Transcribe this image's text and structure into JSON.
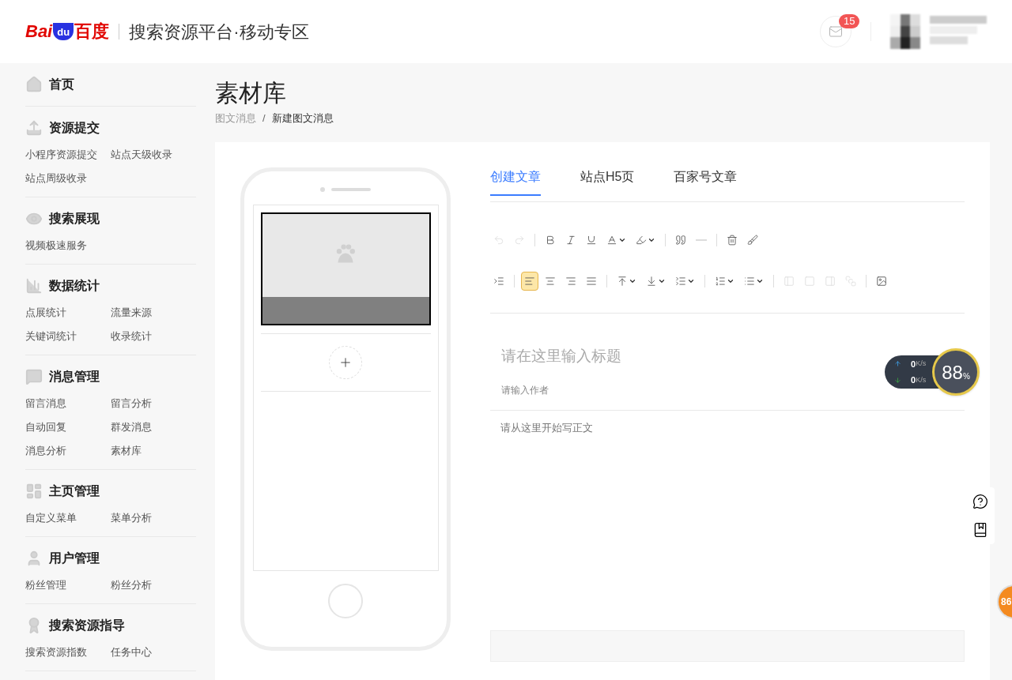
{
  "header": {
    "logo": {
      "latin": "Bai",
      "badge": "du",
      "chinese": "百度"
    },
    "platform_title": "搜索资源平台·移动专区",
    "mail_badge": "15"
  },
  "sidebar": [
    {
      "title": "首页"
    },
    {
      "title": "资源提交",
      "items": [
        "小程序资源提交",
        "站点天级收录",
        "站点周级收录"
      ]
    },
    {
      "title": "搜索展现",
      "items": [
        "视频极速服务"
      ]
    },
    {
      "title": "数据统计",
      "items": [
        "点展统计",
        "流量来源",
        "关键词统计",
        "收录统计"
      ]
    },
    {
      "title": "消息管理",
      "items": [
        "留言消息",
        "留言分析",
        "自动回复",
        "群发消息",
        "消息分析",
        "素材库"
      ]
    },
    {
      "title": "主页管理",
      "items": [
        "自定义菜单",
        "菜单分析"
      ]
    },
    {
      "title": "用户管理",
      "items": [
        "粉丝管理",
        "粉丝分析"
      ]
    },
    {
      "title": "搜索资源指导",
      "items": [
        "搜索资源指数",
        "任务中心"
      ]
    }
  ],
  "page": {
    "title": "素材库",
    "breadcrumb": [
      "图文消息",
      "新建图文消息"
    ],
    "breadcrumb_separator": "/"
  },
  "tabs": [
    {
      "label": "创建文章",
      "selected": true
    },
    {
      "label": "站点H5页",
      "selected": false
    },
    {
      "label": "百家号文章",
      "selected": false
    }
  ],
  "toolbar_rows": [
    [
      {
        "kind": "undo",
        "disabled": true,
        "selected": false,
        "dropdown": false
      },
      {
        "kind": "redo",
        "disabled": true,
        "selected": false,
        "dropdown": false
      },
      {
        "kind": "sep"
      },
      {
        "kind": "bold",
        "disabled": false,
        "selected": false,
        "dropdown": false
      },
      {
        "kind": "italic",
        "disabled": false,
        "selected": false,
        "dropdown": false
      },
      {
        "kind": "underline",
        "disabled": false,
        "selected": false,
        "dropdown": false
      },
      {
        "kind": "fontcolor",
        "disabled": false,
        "selected": false,
        "dropdown": true
      },
      {
        "kind": "highlight",
        "disabled": false,
        "selected": false,
        "dropdown": true
      },
      {
        "kind": "sep"
      },
      {
        "kind": "quote",
        "disabled": false,
        "selected": false,
        "dropdown": false
      },
      {
        "kind": "rule",
        "disabled": true,
        "selected": false,
        "dropdown": false
      },
      {
        "kind": "sep"
      },
      {
        "kind": "trash",
        "disabled": false,
        "selected": false,
        "dropdown": false
      },
      {
        "kind": "brush",
        "disabled": false,
        "selected": false,
        "dropdown": false
      }
    ],
    [
      {
        "kind": "indent",
        "disabled": false,
        "selected": false,
        "dropdown": false
      },
      {
        "kind": "sep"
      },
      {
        "kind": "alignleft",
        "disabled": false,
        "selected": true,
        "dropdown": false
      },
      {
        "kind": "aligncenter",
        "disabled": false,
        "selected": false,
        "dropdown": false
      },
      {
        "kind": "alignright",
        "disabled": false,
        "selected": false,
        "dropdown": false
      },
      {
        "kind": "alignjustify",
        "disabled": false,
        "selected": false,
        "dropdown": false
      },
      {
        "kind": "sep"
      },
      {
        "kind": "spacetop",
        "disabled": false,
        "selected": false,
        "dropdown": true
      },
      {
        "kind": "spacebottom",
        "disabled": false,
        "selected": false,
        "dropdown": true
      },
      {
        "kind": "lineheight",
        "disabled": false,
        "selected": false,
        "dropdown": true
      },
      {
        "kind": "sep"
      },
      {
        "kind": "orderedlist",
        "disabled": false,
        "selected": false,
        "dropdown": true
      },
      {
        "kind": "bulletlist",
        "disabled": false,
        "selected": false,
        "dropdown": true
      },
      {
        "kind": "sep"
      },
      {
        "kind": "floatleft",
        "disabled": true,
        "selected": false,
        "dropdown": false
      },
      {
        "kind": "floatnone",
        "disabled": true,
        "selected": false,
        "dropdown": false
      },
      {
        "kind": "floatright",
        "disabled": true,
        "selected": false,
        "dropdown": false
      },
      {
        "kind": "floatcenter",
        "disabled": true,
        "selected": false,
        "dropdown": false
      },
      {
        "kind": "sep"
      },
      {
        "kind": "image",
        "disabled": false,
        "selected": false,
        "dropdown": false
      }
    ]
  ],
  "editor": {
    "title_placeholder": "请在这里输入标题",
    "author_placeholder": "请输入作者",
    "body_placeholder": "请从这里开始写正文"
  },
  "speed_widget": {
    "upload": "0",
    "download": "0",
    "upload_unit": "K/s",
    "download_unit": "K/s",
    "percent": "88",
    "percent_sign": "%"
  },
  "edge_badge": "86"
}
